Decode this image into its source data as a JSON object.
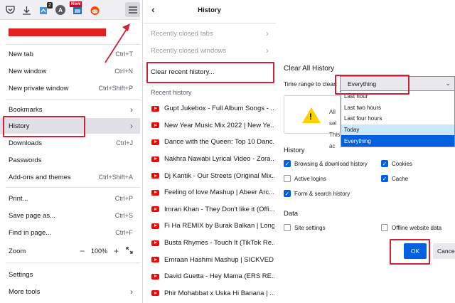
{
  "menu": {
    "items": [
      {
        "label": "New tab",
        "shortcut": "Ctrl+T"
      },
      {
        "label": "New window",
        "shortcut": "Ctrl+N"
      },
      {
        "label": "New private window",
        "shortcut": "Ctrl+Shift+P"
      },
      {
        "label": "Bookmarks",
        "shortcut": ""
      },
      {
        "label": "History",
        "shortcut": ""
      },
      {
        "label": "Downloads",
        "shortcut": "Ctrl+J"
      },
      {
        "label": "Passwords",
        "shortcut": ""
      },
      {
        "label": "Add-ons and themes",
        "shortcut": "Ctrl+Shift+A"
      },
      {
        "label": "Print...",
        "shortcut": "Ctrl+P"
      },
      {
        "label": "Save page as...",
        "shortcut": "Ctrl+S"
      },
      {
        "label": "Find in page...",
        "shortcut": "Ctrl+F"
      },
      {
        "label": "Zoom",
        "shortcut": ""
      },
      {
        "label": "Settings",
        "shortcut": ""
      },
      {
        "label": "More tools",
        "shortcut": ""
      }
    ],
    "zoom": {
      "minus": "−",
      "value": "100%",
      "plus": "+"
    },
    "toolbar": {
      "badge_count": "2",
      "avatar_letter": "A",
      "new_badge": "New"
    },
    "icons": [
      "pocket-icon",
      "download-icon",
      "extension-icon",
      "account-icon",
      "extension-new-icon",
      "reddit-icon",
      "hamburger-menu-icon"
    ]
  },
  "history": {
    "title": "History",
    "closed_tabs": "Recently closed tabs",
    "closed_windows": "Recently closed windows",
    "clear_recent": "Clear recent history...",
    "recent_label": "Recent history",
    "entries": [
      "Gupt Jukebox - Full Album Songs - ...",
      "New Year Music Mix 2022 | New Ye...",
      "Dance with the Queen: Top 10 Danc...",
      "Nakhra Nawabi Lyrical Video - Zora...",
      "Dj Kantik - Our Streets (Original Mix...",
      "Feeling of love Mashup | Abeer Arc...",
      "Imran Khan - They Don't like it (Offi...",
      "Fi Ha REMIX by Burak Balkan | Long...",
      "Busta Rhymes - Touch It (TikTok Re...",
      "Emraan Hashmi Mashup | SICKVED ...",
      "David Guetta - Hey Mama (ERS RE...",
      "Phir Mohabbat x Uska Hi Banana | ..."
    ]
  },
  "dialog": {
    "title": "Clear All History",
    "range_label": "Time range to clear:",
    "range_value": "Everything",
    "options": [
      "Last hour",
      "Last two hours",
      "Last four hours",
      "Today",
      "Everything"
    ],
    "warning_lines": [
      "All sel",
      "This ac"
    ],
    "history_title": "History",
    "history_checks": [
      {
        "label": "Browsing & download history",
        "checked": true
      },
      {
        "label": "Cookies",
        "checked": true
      },
      {
        "label": "Active logins",
        "checked": false
      },
      {
        "label": "Cache",
        "checked": true
      },
      {
        "label": "Form & search history",
        "checked": true
      }
    ],
    "data_title": "Data",
    "data_checks": [
      {
        "label": "Site settings",
        "checked": false
      },
      {
        "label": "Offline website data",
        "checked": false
      }
    ],
    "ok": "OK",
    "cancel": "Cancel",
    "check_glyph": "✓"
  },
  "colors": {
    "accent": "#0060df",
    "annotation": "#d0203a",
    "youtube": "#ff0000",
    "warning": "#ffd100"
  }
}
